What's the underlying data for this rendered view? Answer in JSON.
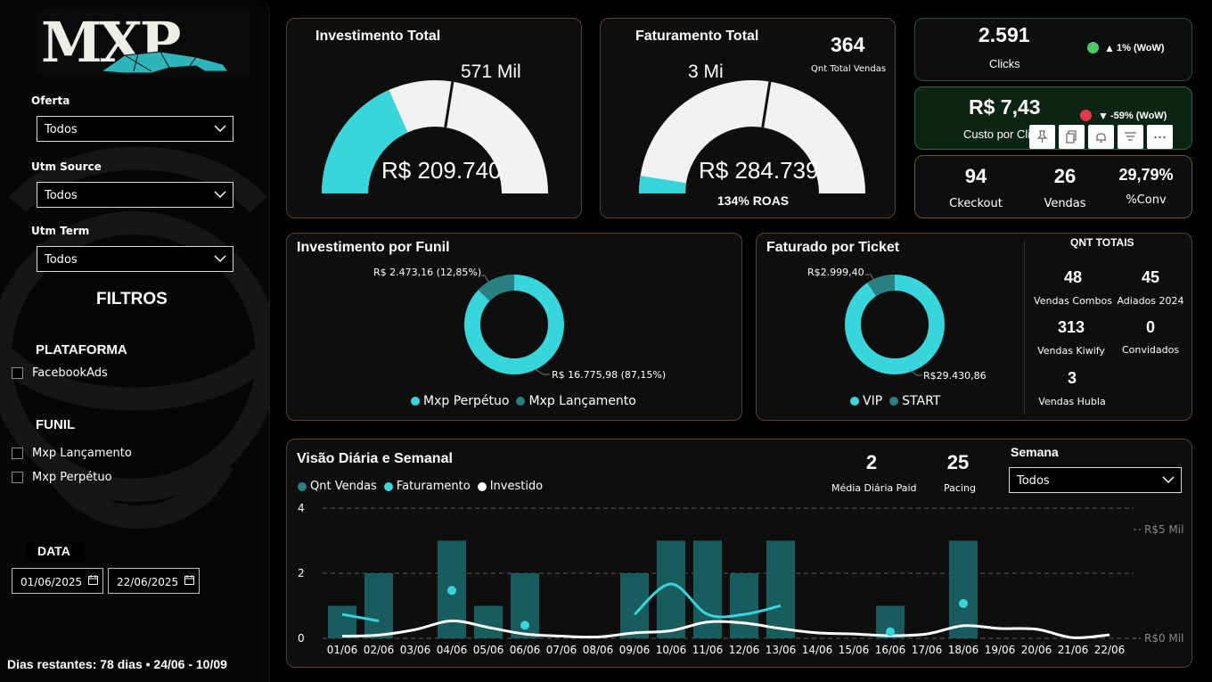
{
  "sidebar": {
    "logo_text": "MXP",
    "oferta": {
      "label": "Oferta",
      "value": "Todos"
    },
    "utm_source": {
      "label": "Utm Source",
      "value": "Todos"
    },
    "utm_term": {
      "label": "Utm Term",
      "value": "Todos"
    },
    "filtros_title": "FILTROS",
    "plataforma": {
      "title": "PLATAFORMA",
      "options": [
        "FacebookAds"
      ]
    },
    "funil": {
      "title": "FUNIL",
      "options": [
        "Mxp Lançamento",
        "Mxp Perpétuo"
      ]
    },
    "data": {
      "label": "DATA",
      "start": "01/06/2025",
      "end": "22/06/2025"
    },
    "dias_restantes": "Dias restantes: 78 dias • 24/06 - 10/09"
  },
  "investimento": {
    "title": "Investimento Total",
    "target": "571 Mil",
    "value": "R$ 209.740",
    "fill_fraction": 0.367,
    "marker_fraction": 0.55
  },
  "faturamento": {
    "title": "Faturamento Total",
    "target": "3 Mi",
    "value": "R$ 284.739",
    "roas": "134% ROAS",
    "qnt": "364",
    "qnt_label": "Qnt Total Vendas",
    "fill_fraction": 0.05,
    "marker_fraction": 0.55
  },
  "clicks": {
    "value": "2.591",
    "label": "Clicks",
    "wow": "1% (WoW)",
    "arrow": "▲",
    "status_color": "#4cc96b"
  },
  "custo": {
    "value": "R$ 7,43",
    "label": "Custo por Click",
    "wow": "-59% (WoW)",
    "arrow": "▼",
    "status_color": "#e03a4a"
  },
  "conv": {
    "checkout": "94",
    "checkout_label": "Ckeckout",
    "vendas": "26",
    "vendas_label": "Vendas",
    "pct": "29,79%",
    "pct_label": "%Conv"
  },
  "funil_chart": {
    "title": "Investimento por Funil",
    "label_small": "R$ 2.473,16 (12,85%)",
    "label_big": "R$ 16.775,98 (87,15%)",
    "legend": [
      "Mxp Perpétuo",
      "Mxp Lançamento"
    ]
  },
  "ticket_chart": {
    "title": "Faturado por Ticket",
    "label_small": "R$2.999,40",
    "label_big": "R$29.430,86",
    "legend": [
      "VIP",
      "START"
    ]
  },
  "qnt_totais": {
    "title": "QNT TOTAIS",
    "items": [
      {
        "value": "48",
        "label": "Vendas Combos"
      },
      {
        "value": "45",
        "label": "Adiados 2024"
      },
      {
        "value": "313",
        "label": "Vendas Kiwify"
      },
      {
        "value": "0",
        "label": "Convidados"
      },
      {
        "value": "3",
        "label": "Vendas Hubla"
      }
    ]
  },
  "daily": {
    "title": "Visão Diária e Semanal",
    "legend": [
      "Qnt Vendas",
      "Faturamento",
      "Investido"
    ],
    "media_value": "2",
    "media_label": "Média Diária Paid",
    "pacing_value": "25",
    "pacing_label": "Pacing",
    "semana_label": "Semana",
    "semana_value": "Todos"
  },
  "colors": {
    "accent": "#37d5dc",
    "dark_teal": "#2a7f80",
    "bar": "#185c5e",
    "border": "#5a3f2c"
  },
  "chart_data": {
    "type": "bar",
    "title": "Visão Diária e Semanal",
    "categories": [
      "01/06",
      "02/06",
      "03/06",
      "04/06",
      "05/06",
      "06/06",
      "07/06",
      "08/06",
      "09/06",
      "10/06",
      "11/06",
      "12/06",
      "13/06",
      "14/06",
      "15/06",
      "16/06",
      "17/06",
      "18/06",
      "19/06",
      "20/06",
      "21/06",
      "22/06"
    ],
    "y_ticks": [
      "0",
      "2",
      "4"
    ],
    "y2_ticks": [
      "R$0 Mil",
      "R$5 Mil"
    ],
    "ylim": [
      0,
      4
    ],
    "y2lim": [
      0,
      5000
    ],
    "series": [
      {
        "name": "Qnt Vendas",
        "type": "bar",
        "values": [
          1,
          2,
          0,
          3,
          1,
          2,
          0,
          0,
          2,
          3,
          3,
          2,
          3,
          0,
          0,
          1,
          0,
          3,
          0,
          0,
          0,
          0
        ]
      },
      {
        "name": "Faturamento",
        "type": "line",
        "axis": "y2",
        "values": [
          1100,
          800,
          null,
          2200,
          null,
          600,
          null,
          null,
          1100,
          2500,
          1100,
          1100,
          1500,
          null,
          null,
          300,
          null,
          1600,
          null,
          null,
          null,
          null
        ]
      },
      {
        "name": "Investido",
        "type": "line",
        "axis": "y2",
        "values": [
          100,
          150,
          400,
          800,
          500,
          200,
          100,
          60,
          250,
          350,
          750,
          700,
          450,
          250,
          200,
          120,
          200,
          580,
          450,
          420,
          30,
          160
        ]
      }
    ]
  }
}
